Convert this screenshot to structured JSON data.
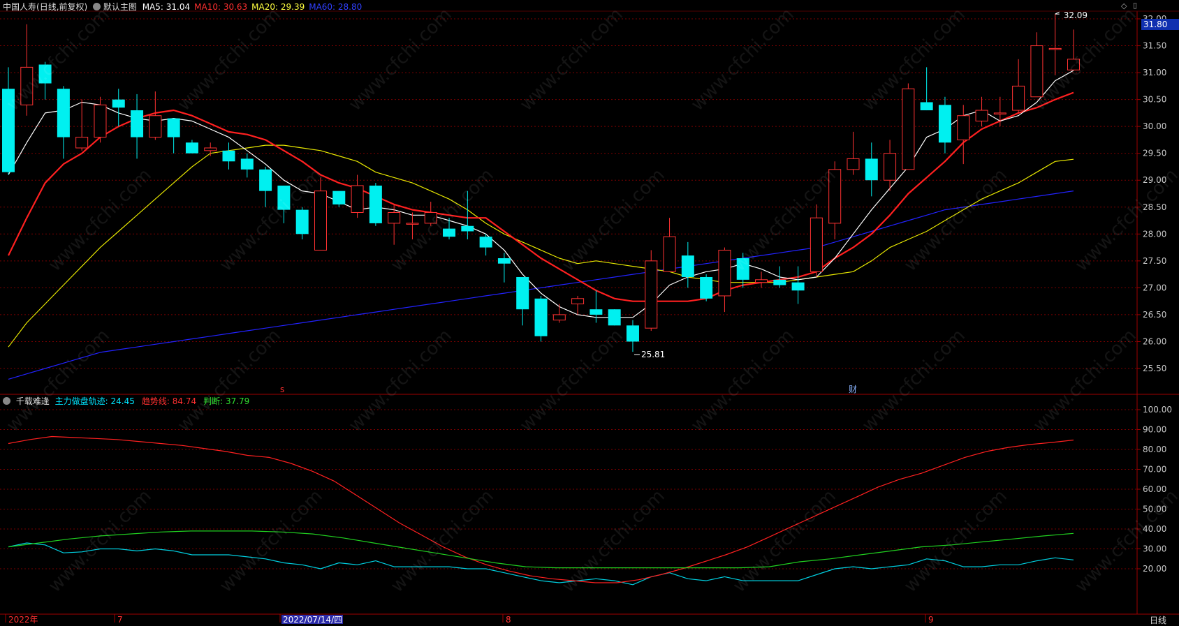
{
  "header": {
    "stock_name": "中国人寿",
    "period_label": "(日线,前复权)",
    "main_chart_label": "默认主图",
    "ma_labels": [
      {
        "text": "MA5: 31.04",
        "color": "#ffffff"
      },
      {
        "text": "MA10: 30.63",
        "color": "#ff3030"
      },
      {
        "text": "MA20: 29.39",
        "color": "#ffff40"
      },
      {
        "text": "MA60: 28.80",
        "color": "#3040ff"
      }
    ]
  },
  "sub_header": {
    "indicator_name": "千载难逢",
    "labels": [
      {
        "text": "主力做盘轨迹: 24.45",
        "color": "#00e5ff"
      },
      {
        "text": "趋势线: 84.74",
        "color": "#ff3030"
      },
      {
        "text": "判断: 37.79",
        "color": "#30e030"
      }
    ]
  },
  "price_tag": "31.80",
  "markers": {
    "high": "32.09",
    "low": "25.81",
    "event_s": "s",
    "event_cai": "财"
  },
  "bottom_axis": {
    "labels": [
      "2022年",
      "7",
      "2022/07/14/四",
      "8",
      "9"
    ],
    "period_button": "日线"
  },
  "colors": {
    "up": "#ff3232",
    "down": "#00f0f0",
    "grid": "#7a0000",
    "axis_text": "#c8c8c8",
    "ma5": "#ffffff",
    "ma10": "#ff2020",
    "ma20": "#e6e600",
    "ma60": "#2222ff",
    "track": "#00cfe0",
    "trend": "#ff2020",
    "judge": "#20d020"
  },
  "chart_data": [
    {
      "type": "candlestick",
      "title": "中国人寿 (日线,前复权)",
      "y_ticks": [
        25.5,
        26.0,
        26.5,
        27.0,
        27.5,
        28.0,
        28.5,
        29.0,
        29.5,
        30.0,
        30.5,
        31.0,
        31.5,
        32.0
      ],
      "ylim": [
        25.1,
        32.25
      ],
      "candles": [
        [
          30.7,
          29.15,
          31.1,
          29.1
        ],
        [
          30.4,
          31.1,
          31.9,
          30.2
        ],
        [
          31.15,
          30.8,
          31.2,
          30.5
        ],
        [
          30.7,
          29.8,
          30.75,
          29.4
        ],
        [
          29.6,
          29.8,
          30.5,
          29.55
        ],
        [
          29.8,
          30.4,
          30.55,
          29.7
        ],
        [
          30.5,
          30.35,
          30.7,
          30.0
        ],
        [
          30.3,
          29.8,
          30.6,
          29.4
        ],
        [
          29.8,
          30.2,
          30.65,
          29.75
        ],
        [
          30.15,
          29.8,
          30.15,
          29.5
        ],
        [
          29.7,
          29.5,
          29.75,
          29.5
        ],
        [
          29.55,
          29.6,
          29.7,
          29.45
        ],
        [
          29.55,
          29.35,
          29.7,
          29.2
        ],
        [
          29.4,
          29.2,
          29.5,
          29.05
        ],
        [
          29.2,
          28.8,
          29.25,
          28.5
        ],
        [
          28.9,
          28.45,
          28.9,
          28.2
        ],
        [
          28.45,
          28.0,
          28.5,
          27.9
        ],
        [
          27.7,
          28.8,
          29.05,
          27.7
        ],
        [
          28.8,
          28.55,
          28.8,
          28.5
        ],
        [
          28.4,
          28.9,
          29.1,
          28.3
        ],
        [
          28.9,
          28.2,
          28.95,
          28.15
        ],
        [
          28.2,
          28.4,
          28.55,
          27.8
        ],
        [
          28.2,
          28.2,
          28.4,
          27.9
        ],
        [
          28.2,
          28.4,
          28.6,
          28.15
        ],
        [
          28.1,
          27.95,
          28.3,
          27.9
        ],
        [
          28.15,
          28.05,
          28.8,
          27.9
        ],
        [
          27.95,
          27.75,
          28.0,
          27.6
        ],
        [
          27.55,
          27.45,
          27.65,
          27.1
        ],
        [
          27.2,
          26.6,
          27.2,
          26.3
        ],
        [
          26.8,
          26.1,
          26.85,
          26.0
        ],
        [
          26.4,
          26.5,
          26.7,
          26.35
        ],
        [
          26.7,
          26.8,
          26.85,
          26.5
        ],
        [
          26.6,
          26.5,
          26.95,
          26.35
        ],
        [
          26.6,
          26.3,
          26.6,
          26.3
        ],
        [
          26.3,
          26.0,
          26.4,
          25.81
        ],
        [
          26.25,
          27.5,
          27.7,
          26.2
        ],
        [
          27.3,
          27.95,
          28.3,
          27.3
        ],
        [
          27.6,
          27.2,
          27.85,
          27.0
        ],
        [
          27.2,
          26.8,
          27.25,
          26.75
        ],
        [
          26.85,
          27.7,
          27.75,
          26.55
        ],
        [
          27.55,
          27.15,
          27.65,
          27.0
        ],
        [
          27.1,
          27.15,
          27.3,
          27.0
        ],
        [
          27.15,
          27.05,
          27.4,
          27.0
        ],
        [
          27.1,
          26.95,
          27.4,
          26.7
        ],
        [
          27.3,
          28.3,
          28.55,
          27.2
        ],
        [
          28.2,
          29.2,
          29.35,
          27.9
        ],
        [
          29.2,
          29.4,
          29.9,
          29.1
        ],
        [
          29.4,
          29.0,
          29.7,
          28.7
        ],
        [
          29.0,
          29.5,
          29.75,
          28.8
        ],
        [
          29.2,
          30.7,
          30.8,
          29.2
        ],
        [
          30.45,
          30.3,
          31.1,
          30.3
        ],
        [
          30.4,
          29.7,
          30.55,
          29.5
        ],
        [
          29.75,
          30.2,
          30.4,
          29.3
        ],
        [
          30.1,
          30.3,
          30.55,
          30.0
        ],
        [
          30.25,
          30.25,
          30.55,
          30.0
        ],
        [
          30.3,
          30.75,
          31.25,
          30.25
        ],
        [
          30.55,
          31.5,
          31.75,
          30.55
        ],
        [
          31.45,
          31.45,
          32.09,
          30.95
        ],
        [
          31.05,
          31.25,
          31.8,
          31.05
        ]
      ],
      "ma5": [
        29.1,
        29.7,
        30.25,
        30.3,
        30.45,
        30.4,
        30.25,
        30.15,
        30.1,
        30.15,
        30.1,
        29.95,
        29.8,
        29.55,
        29.3,
        29.0,
        28.8,
        28.75,
        28.6,
        28.45,
        28.5,
        28.45,
        28.35,
        28.35,
        28.25,
        28.15,
        28.0,
        27.7,
        27.25,
        26.9,
        26.65,
        26.5,
        26.45,
        26.45,
        26.45,
        26.7,
        27.05,
        27.2,
        27.3,
        27.35,
        27.45,
        27.35,
        27.2,
        27.15,
        27.2,
        27.55,
        28.0,
        28.45,
        28.85,
        29.25,
        29.8,
        29.95,
        30.2,
        30.3,
        30.1,
        30.2,
        30.45,
        30.85,
        31.04
      ],
      "ma10": [
        27.6,
        28.3,
        28.95,
        29.3,
        29.5,
        29.8,
        30.0,
        30.15,
        30.25,
        30.3,
        30.2,
        30.05,
        29.9,
        29.85,
        29.75,
        29.55,
        29.35,
        29.1,
        28.95,
        28.85,
        28.7,
        28.55,
        28.45,
        28.4,
        28.35,
        28.3,
        28.3,
        28.05,
        27.8,
        27.55,
        27.35,
        27.15,
        26.95,
        26.8,
        26.75,
        26.75,
        26.75,
        26.75,
        26.8,
        26.95,
        27.05,
        27.1,
        27.15,
        27.2,
        27.3,
        27.55,
        27.75,
        28.0,
        28.35,
        28.75,
        29.05,
        29.35,
        29.7,
        29.95,
        30.1,
        30.25,
        30.35,
        30.5,
        30.63
      ],
      "ma20": [
        25.9,
        26.35,
        26.7,
        27.05,
        27.4,
        27.75,
        28.05,
        28.35,
        28.65,
        28.95,
        29.25,
        29.5,
        29.55,
        29.6,
        29.65,
        29.65,
        29.6,
        29.55,
        29.45,
        29.35,
        29.15,
        29.05,
        28.95,
        28.8,
        28.65,
        28.45,
        28.2,
        28.0,
        27.85,
        27.7,
        27.55,
        27.45,
        27.5,
        27.45,
        27.4,
        27.35,
        27.3,
        27.2,
        27.15,
        27.1,
        27.1,
        27.1,
        27.1,
        27.15,
        27.2,
        27.25,
        27.3,
        27.5,
        27.75,
        27.9,
        28.05,
        28.25,
        28.45,
        28.65,
        28.8,
        28.95,
        29.15,
        29.35,
        29.39
      ],
      "ma60": [
        25.3,
        25.4,
        25.5,
        25.6,
        25.7,
        25.8,
        25.85,
        25.9,
        25.95,
        26.0,
        26.05,
        26.1,
        26.15,
        26.2,
        26.25,
        26.3,
        26.35,
        26.4,
        26.45,
        26.5,
        26.55,
        26.6,
        26.65,
        26.7,
        26.75,
        26.8,
        26.85,
        26.9,
        26.95,
        27.0,
        27.05,
        27.1,
        27.15,
        27.2,
        27.25,
        27.3,
        27.35,
        27.4,
        27.45,
        27.5,
        27.55,
        27.6,
        27.65,
        27.7,
        27.75,
        27.85,
        27.95,
        28.05,
        28.15,
        28.25,
        28.35,
        28.45,
        28.5,
        28.55,
        28.6,
        28.65,
        28.7,
        28.75,
        28.8
      ]
    },
    {
      "type": "line",
      "title": "千载难逢",
      "y_ticks": [
        20,
        30,
        40,
        50,
        60,
        70,
        80,
        90,
        100
      ],
      "ylim": [
        10,
        105
      ],
      "series": [
        {
          "name": "主力做盘轨迹",
          "values": [
            31,
            33,
            32,
            28,
            28.5,
            30,
            30,
            29,
            30,
            29,
            27,
            27,
            27,
            26,
            25,
            23,
            22,
            20,
            23,
            22,
            24,
            21,
            21,
            21,
            21,
            20,
            20,
            18,
            16,
            14,
            13,
            14,
            15,
            14,
            12,
            16,
            18,
            15,
            14,
            16,
            14,
            14,
            14,
            14,
            17,
            20,
            21,
            20,
            21,
            22,
            25,
            24,
            21,
            21,
            22,
            22,
            24,
            25.5,
            24.45
          ]
        },
        {
          "name": "趋势线",
          "values": [
            83,
            85,
            86.5,
            86,
            85.5,
            85,
            84,
            83,
            82,
            80.5,
            79,
            77,
            76,
            73,
            69,
            64,
            57,
            50,
            43,
            37,
            31,
            26,
            22,
            19,
            16.5,
            15,
            14,
            13,
            13,
            14.5,
            17,
            20,
            23.5,
            27,
            31,
            36,
            41,
            46,
            51,
            56,
            61,
            65,
            68,
            72,
            76,
            79,
            81,
            82.5,
            83.5,
            84.74
          ]
        },
        {
          "name": "判断",
          "values": [
            31,
            33,
            35,
            36.5,
            37.5,
            38.5,
            39,
            39,
            39,
            38.5,
            37.5,
            35.5,
            33,
            30.5,
            28,
            25.5,
            23,
            21,
            20.5,
            20.5,
            20.5,
            20.5,
            20.5,
            20.5,
            20.5,
            21,
            23.5,
            25,
            27,
            29,
            31,
            32,
            33.5,
            35,
            36.5,
            37.79
          ]
        }
      ]
    }
  ]
}
